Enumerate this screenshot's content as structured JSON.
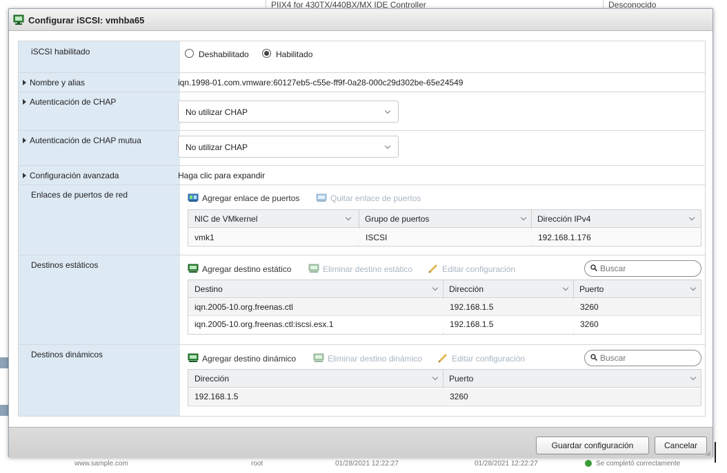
{
  "background": {
    "top_left_text": "PIIX4 for 430TX/440BX/MX IDE Controller",
    "top_right_text": "Desconocido",
    "bottom_cells": [
      "www.sample.com",
      "root",
      "01/28/2021 12:22:27",
      "01/28/2021 12:22:27",
      "Se completó correctamente"
    ]
  },
  "dialog": {
    "title": "Configurar iSCSI: vmhba65",
    "rows": {
      "iscsi": {
        "label": "iSCSI habilitado",
        "options": [
          "Deshabilitado",
          "Habilitado"
        ],
        "selected": "Habilitado"
      },
      "name": {
        "label": "Nombre y alias",
        "value": "iqn.1998-01.com.vmware:60127eb5-c55e-ff9f-0a28-000c29d302be-65e24549"
      },
      "chap": {
        "label": "Autenticación de CHAP",
        "value": "No utilizar CHAP"
      },
      "mutual_chap": {
        "label": "Autenticación de CHAP mutua",
        "value": "No utilizar CHAP"
      },
      "advanced": {
        "label": "Configuración avanzada",
        "value": "Haga clic para expandir"
      },
      "port_bindings": {
        "label": "Enlaces de puertos de red",
        "add_label": "Agregar enlace de puertos",
        "remove_label": "Quitar enlace de puertos",
        "columns": [
          "NIC de VMkernel",
          "Grupo de puertos",
          "Dirección IPv4"
        ],
        "rows": [
          [
            "vmk1",
            "ISCSI",
            "192.168.1.176"
          ]
        ]
      },
      "static_targets": {
        "label": "Destinos estáticos",
        "add_label": "Agregar destino estático",
        "remove_label": "Eliminar destino estático",
        "edit_label": "Editar configuración",
        "search_placeholder": "Buscar",
        "columns": [
          "Destino",
          "Dirección",
          "Puerto"
        ],
        "rows": [
          [
            "iqn.2005-10.org.freenas.ctl",
            "192.168.1.5",
            "3260"
          ],
          [
            "iqn.2005-10.org.freenas.ctl:iscsi.esx.1",
            "192.168.1.5",
            "3260"
          ]
        ]
      },
      "dynamic_targets": {
        "label": "Destinos dinámicos",
        "add_label": "Agregar destino dinámico",
        "remove_label": "Eliminar destino dinámico",
        "edit_label": "Editar configuración",
        "search_placeholder": "Buscar",
        "columns": [
          "Dirección",
          "Puerto"
        ],
        "rows": [
          [
            "192.168.1.5",
            "3260"
          ]
        ]
      }
    },
    "footer": {
      "save_label": "Guardar configuración",
      "cancel_label": "Cancelar"
    }
  },
  "colors": {
    "label_column": "#dde9f3",
    "disabled_text": "#a9b6c2",
    "footer": "#d6d6d6"
  },
  "icons": {
    "title": "network-adapter-icon",
    "add_binding": "nic-add-icon",
    "remove_binding": "nic-remove-icon",
    "add_target": "target-add-icon",
    "remove_target": "target-remove-icon",
    "edit": "pencil-icon",
    "search": "search-icon"
  }
}
